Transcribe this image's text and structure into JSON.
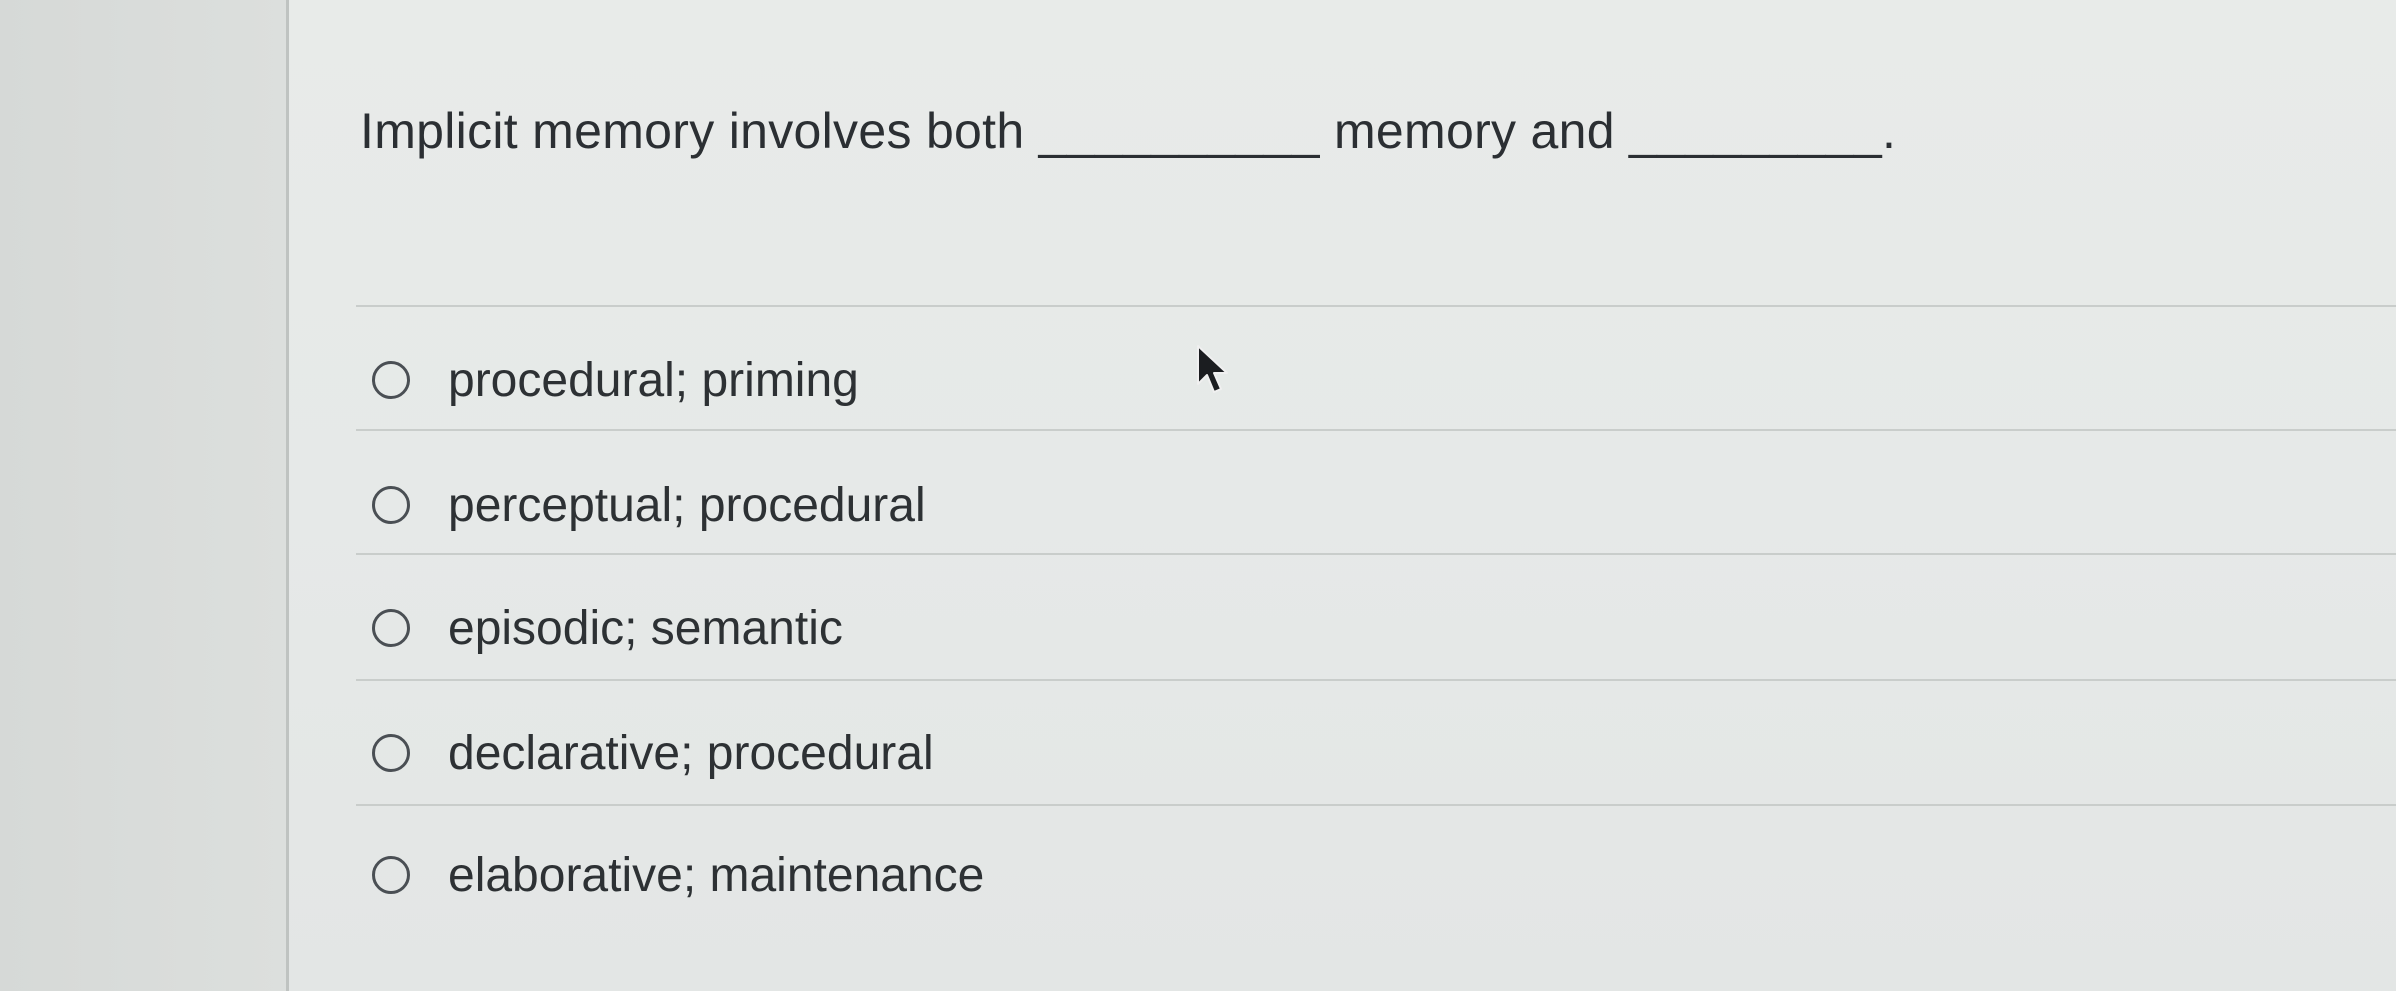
{
  "question": {
    "text_before": "Implicit memory involves both",
    "blank_1": "__________",
    "text_middle": "memory and",
    "blank_2": "_________."
  },
  "options": [
    {
      "label": "procedural; priming",
      "selected": false
    },
    {
      "label": "perceptual; procedural",
      "selected": false
    },
    {
      "label": "episodic; semantic",
      "selected": false
    },
    {
      "label": "declarative; procedural",
      "selected": false
    },
    {
      "label": "elaborative; maintenance",
      "selected": false
    }
  ],
  "cursor": {
    "icon": "arrow-pointer-icon"
  }
}
